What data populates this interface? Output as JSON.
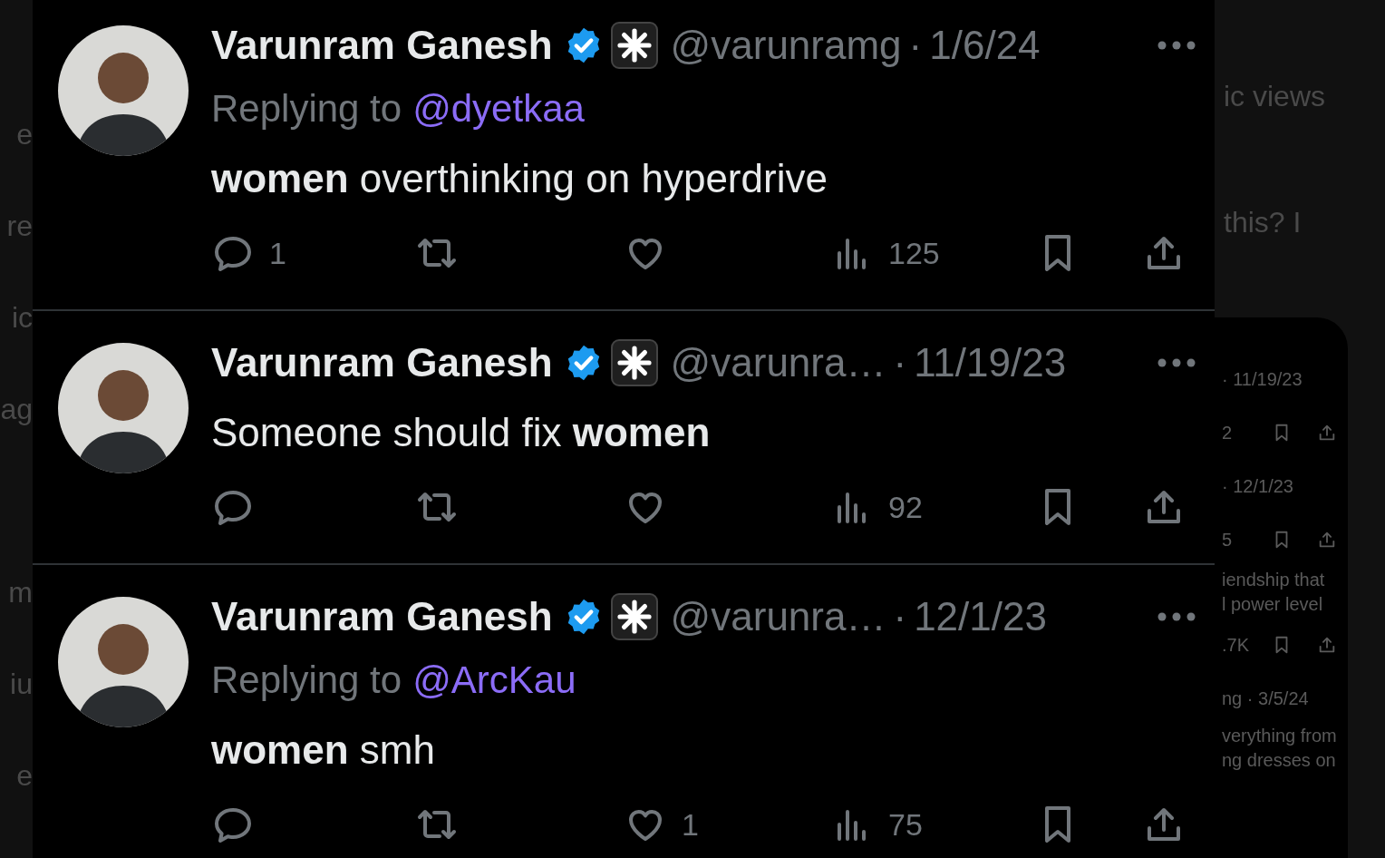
{
  "background_left": [
    "e",
    "re",
    "ic",
    "ag",
    "m",
    "iu",
    "e"
  ],
  "background_right": [
    "ic views",
    "this? I"
  ],
  "background_card": [
    {
      "kind": "date",
      "text": "· 11/19/23"
    },
    {
      "kind": "actions",
      "text": "2"
    },
    {
      "kind": "date",
      "text": "· 12/1/23"
    },
    {
      "kind": "actions",
      "text": "5"
    },
    {
      "kind": "line",
      "text": "iendship that"
    },
    {
      "kind": "line",
      "text": "l power level"
    },
    {
      "kind": "actions",
      "text": ".7K"
    },
    {
      "kind": "date",
      "text": "ng · 3/5/24"
    },
    {
      "kind": "line",
      "text": "verything from"
    },
    {
      "kind": "line",
      "text": "ng dresses on"
    }
  ],
  "tweets": [
    {
      "name": "Varunram Ganesh",
      "verified": true,
      "handle": "@varunramg",
      "dot": "·",
      "date": "1/6/24",
      "replying_label": "Replying to",
      "replying_to": "@dyetkaa",
      "text": "**women** overthinking on hyperdrive",
      "replies": "1",
      "views": "125"
    },
    {
      "name": "Varunram Ganesh",
      "verified": true,
      "handle": "@varunra…",
      "dot": "·",
      "date": "11/19/23",
      "text": "Someone should fix **women**",
      "views": "92"
    },
    {
      "name": "Varunram Ganesh",
      "verified": true,
      "handle": "@varunra…",
      "dot": "·",
      "date": "12/1/23",
      "replying_label": "Replying to",
      "replying_to": "@ArcKau",
      "text": "**women** smh",
      "likes": "1",
      "views": "75"
    }
  ]
}
